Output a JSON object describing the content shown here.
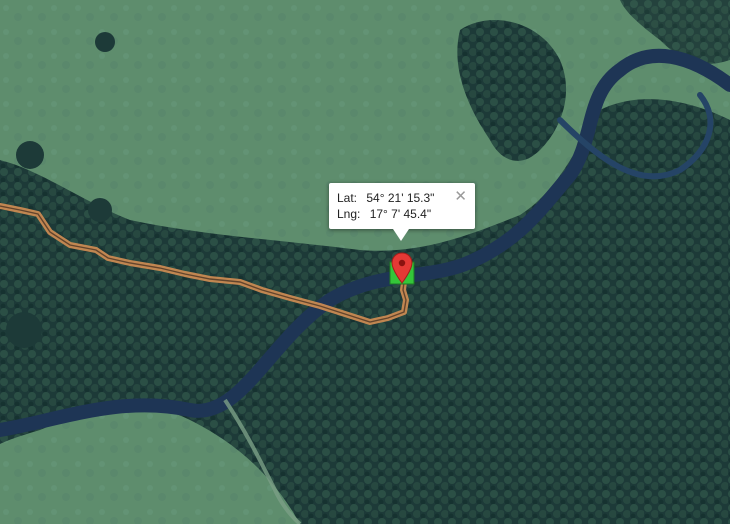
{
  "popup": {
    "lat_label": "Lat:",
    "lat_value": "54° 21' 15.3\"",
    "lng_label": "Lng:",
    "lng_value": "17° 7' 45.4\"",
    "close_glyph": "✕"
  },
  "marker": {
    "pin_color": "#e53935",
    "badge_color": "#34c639",
    "icon": "map-pin-icon"
  },
  "track": {
    "color": "#c98a52"
  },
  "colors": {
    "meadow": "#5f8f6e",
    "forest": "#1f3d3a",
    "river": "#1e3555"
  }
}
